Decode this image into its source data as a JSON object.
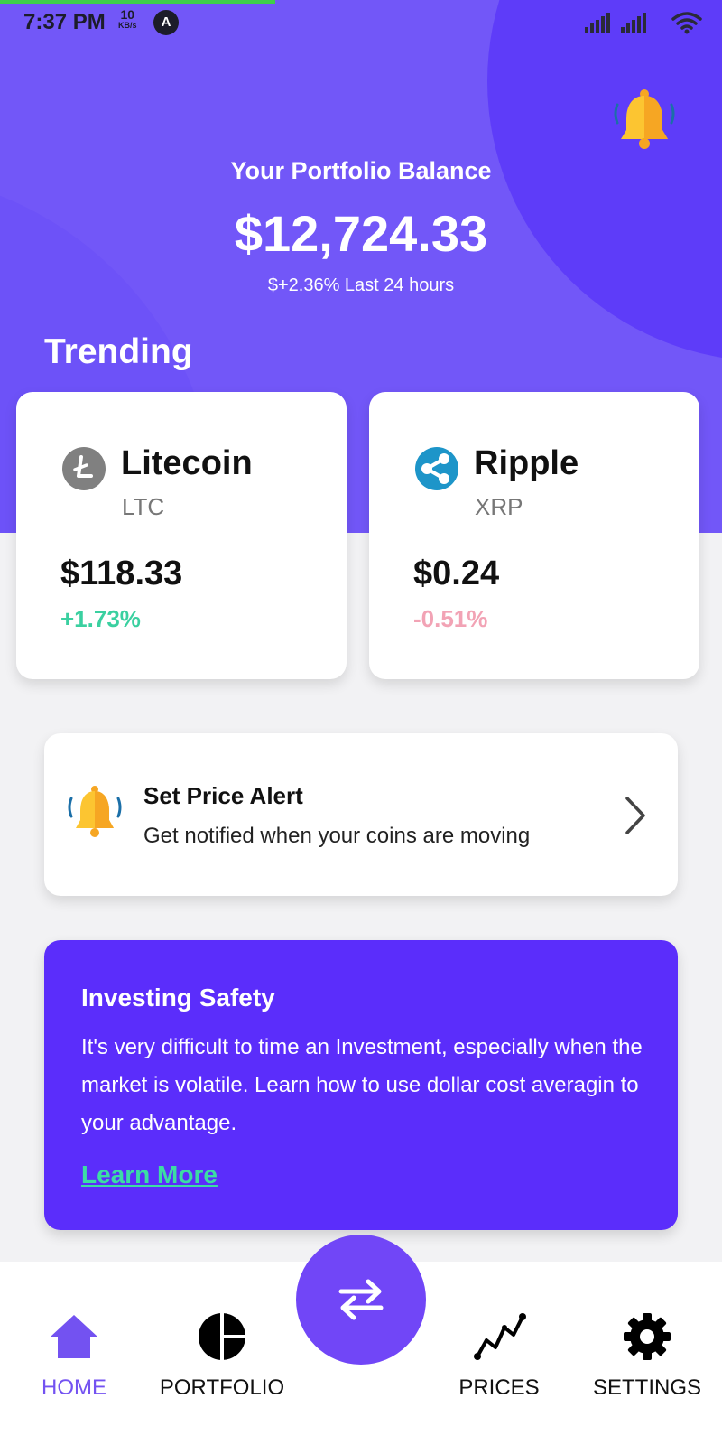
{
  "status_bar": {
    "time": "7:37 PM",
    "network_speed": "10",
    "network_unit": "KB/s",
    "nav_badge": "A"
  },
  "header": {
    "alert_icon": "bell-icon",
    "balance_label": "Your Portfolio Balance",
    "balance_value": "$12,724.33",
    "balance_change": "$+2.36% Last 24 hours",
    "trending_title": "Trending"
  },
  "trending": [
    {
      "name": "Litecoin",
      "symbol": "LTC",
      "price": "$118.33",
      "change": "+1.73%",
      "direction": "up",
      "icon": "litecoin-icon",
      "icon_color": "#808080"
    },
    {
      "name": "Ripple",
      "symbol": "XRP",
      "price": "$0.24",
      "change": "-0.51%",
      "direction": "down",
      "icon": "ripple-icon",
      "icon_color": "#1d95c9"
    }
  ],
  "price_alert": {
    "title": "Set Price Alert",
    "subtitle": "Get notified when your coins are moving"
  },
  "safety": {
    "title": "Investing Safety",
    "body": "It's very difficult to time an Investment, especially when the market is volatile. Learn how to use dollar cost averagin to your advantage.",
    "link": "Learn More"
  },
  "bottom_nav": {
    "home": "HOME",
    "portfolio": "PORTFOLIO",
    "prices": "PRICES",
    "settings": "SETTINGS",
    "active": "home"
  },
  "colors": {
    "accent": "#5b2dfb",
    "header_bg": "#7257f8",
    "positive": "#3ad0a0",
    "negative": "#f2a3b5",
    "active_tab": "#7352f1"
  }
}
